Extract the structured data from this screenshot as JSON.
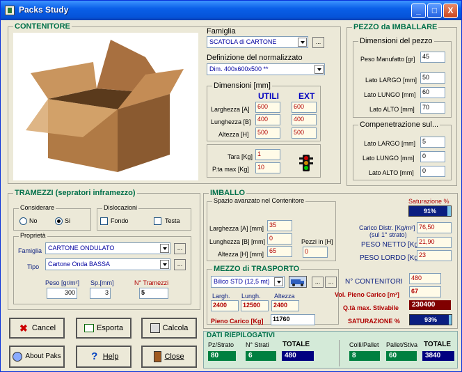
{
  "window": {
    "title": "Packs Study",
    "min": "_",
    "max": "□",
    "close": "X"
  },
  "contenitore": {
    "legend": "CONTENITORE",
    "famiglia_label": "Famiglia",
    "famiglia_value": "SCATOLA di CARTONE",
    "definizione_label": "Definizione del normalizzato",
    "definizione_value": "Dim. 400x600x500 **",
    "dimensioni_label": "Dimensioni [mm]",
    "utili": "UTILI",
    "ext": "EXT",
    "larghezza_label": "Larghezza [A]",
    "lunghezza_label": "Lunghezza [B]",
    "altezza_label": "Altezza [H]",
    "utili_vals": [
      "600",
      "400",
      "500"
    ],
    "ext_vals": [
      "600",
      "400",
      "500"
    ],
    "tara_label": "Tara [Kg]",
    "tara_value": "1",
    "ptamax_label": "P.ta max [Kg]",
    "ptamax_value": "10",
    "more": "..."
  },
  "pezzo": {
    "legend": "PEZZO da IMBALLARE",
    "dim_legend": "Dimensioni del pezzo",
    "peso_label": "Peso Manufatto [gr]",
    "peso_value": "45",
    "largo_label": "Lato LARGO [mm]",
    "largo_value": "50",
    "lungo_label": "Lato LUNGO [mm]",
    "lungo_value": "60",
    "alto_label": "Lato ALTO [mm]",
    "alto_value": "70",
    "comp_legend": "Compenetrazione sul...",
    "c_largo_value": "5",
    "c_lungo_value": "0",
    "c_alto_value": "0"
  },
  "tramezzi": {
    "legend": "TRAMEZZI (sepratori inframezzo)",
    "considerare_legend": "Considerare",
    "no_label": "No",
    "si_label": "Si",
    "dislocazioni_legend": "Dislocazioni",
    "fondo_label": "Fondo",
    "testa_label": "Testa",
    "proprieta_legend": "Proprietà",
    "famiglia_label": "Famiglia",
    "famiglia_value": "CARTONE ONDULATO",
    "tipo_label": "Tipo",
    "tipo_value": "Cartone Onda BASSA",
    "peso_label": "Peso [gr/m²]",
    "peso_value": "300",
    "sp_label": "Sp.[mm]",
    "sp_value": "3",
    "n_label": "N° Tramezzi",
    "n_value": "5"
  },
  "imballo": {
    "legend": "IMBALLO",
    "spazio_legend": "Spazio avanzato nel Contenitore",
    "larghezza_label": "Larghezza [A]  [mm]",
    "larghezza_value": "35",
    "lunghezza_label": "Lunghezza [B]  [mm]",
    "lunghezza_value": "0",
    "altezza_label": "Altezza [H]  [mm]",
    "altezza_value": "65",
    "pezzi_label": "Pezzi in [H]",
    "pezzi_value": "0",
    "saturazione_label": "Saturazione %",
    "saturazione_value": "91%",
    "saturazione_fraction": 0.91,
    "carico_label": "Carico Distr. [Kg/m²]",
    "carico_sub": "(sul 1° strato)",
    "carico_value": "76,50",
    "netto_label": "PESO NETTO [Kg]",
    "netto_value": "21,90",
    "lordo_label": "PESO LORDO [Kg]",
    "lordo_value": "23"
  },
  "mezzo": {
    "legend": "MEZZO di TRASPORTO",
    "value": "Bilico STD (12,5 mt)",
    "largh_label": "Largh.",
    "largh_value": "2400",
    "lungh_label": "Lungh.",
    "lungh_value": "12500",
    "altezza_label": "Altezza",
    "altezza_value": "2400",
    "pieno_label": "Pieno Carico [Kg]",
    "pieno_value": "11760",
    "ncont_label": "N° CONTENITORI",
    "ncont_value": "480",
    "vol_label": "Vol. Pieno Carico [m³]",
    "vol_value": "67",
    "qta_label": "Q.tà max. Stivabile",
    "qta_value": "230400",
    "sat_label": "SATURAZIONE %",
    "sat_value": "93%",
    "sat_fraction": 0.93
  },
  "riepilogo": {
    "legend": "DATI RIEPILOGATIVI",
    "pz_label": "Pz/Strato",
    "pz_value": "80",
    "nstrati_label": "N° Strati",
    "nstrati_value": "6",
    "totale_label": "TOTALE",
    "totale_value": "480",
    "colli_label": "Colli/Pallet",
    "colli_value": "8",
    "pallet_label": "Pallet/Stiva",
    "pallet_value": "60",
    "totale2_label": "TOTALE",
    "totale2_value": "3840"
  },
  "buttons": {
    "cancel": "Cancel",
    "esporta": "Esporta",
    "calcola": "Calcola",
    "about": "About Paks",
    "help": "Help",
    "close": "Close"
  }
}
